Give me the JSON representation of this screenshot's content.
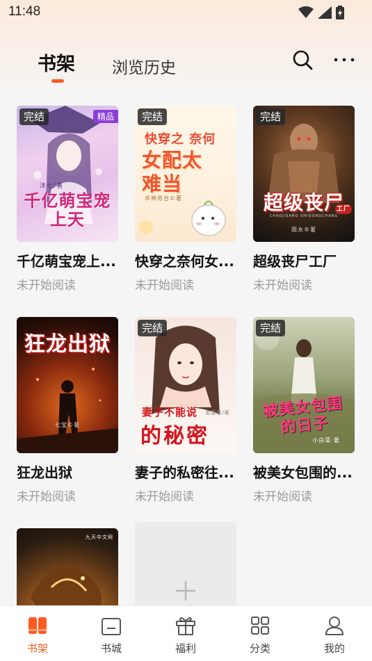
{
  "status_bar": {
    "time": "11:48"
  },
  "header": {
    "tabs": [
      {
        "label": "书架",
        "active": true
      },
      {
        "label": "浏览历史",
        "active": false
      }
    ],
    "accent_color": "#ff5a1f"
  },
  "books": [
    {
      "title": "千亿萌宝宠上...",
      "status": "未开始阅读",
      "badge": "完结",
      "tag": "精品",
      "cover_text": "千亿萌宝宠上天",
      "cover_author": "沐七/著"
    },
    {
      "title": "快穿之奈何女...",
      "status": "未开始阅读",
      "badge": "完结",
      "cover_text_top": "快穿之 奈何",
      "cover_text": "女配太难当",
      "cover_author": "半神苏合©著"
    },
    {
      "title": "超级丧尸工厂",
      "status": "未开始阅读",
      "badge": "完结",
      "cover_text": "超级丧尸",
      "cover_sub": "工厂",
      "cover_small": "CHAOJISANG SHIGONGCHANG",
      "cover_author": "雨水®著"
    },
    {
      "title": "狂龙出狱",
      "status": "未开始阅读",
      "badge": "",
      "cover_text": "狂龙出狱",
      "cover_author": "七宝©著"
    },
    {
      "title": "妻子的私密往...",
      "status": "未开始阅读",
      "badge": "完结",
      "cover_text_top": "妻子不能说",
      "cover_text": "的秘密",
      "cover_author": "君莫歌/著"
    },
    {
      "title": "被美女包围的...",
      "status": "未开始阅读",
      "badge": "完结",
      "cover_text": "被美女包围的日子",
      "cover_author": "小白菜·著"
    },
    {
      "title": "",
      "status": "",
      "badge": "",
      "cover_text": "",
      "cover_corner": "九天中文网"
    }
  ],
  "bottom_nav": [
    {
      "label": "书架",
      "icon": "bookshelf-icon",
      "active": true
    },
    {
      "label": "书城",
      "icon": "store-icon",
      "active": false
    },
    {
      "label": "福利",
      "icon": "gift-icon",
      "active": false
    },
    {
      "label": "分类",
      "icon": "category-grid-icon",
      "active": false
    },
    {
      "label": "我的",
      "icon": "profile-icon",
      "active": false
    }
  ]
}
